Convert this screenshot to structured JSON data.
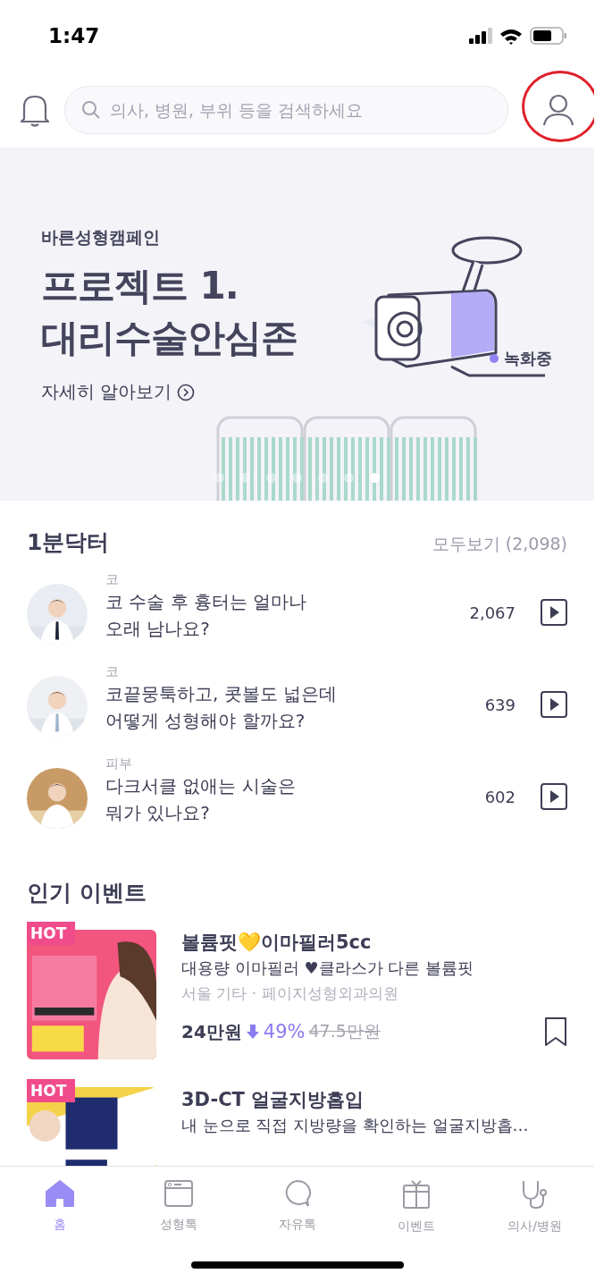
{
  "status_bar": {
    "time": "1:47"
  },
  "header": {
    "search": {
      "placeholder": "의사, 병원, 부위 등을 검색하세요"
    },
    "profile_button": {
      "highlighted": true
    }
  },
  "banner": {
    "eyebrow": "바른성형캠페인",
    "title_lines": [
      "프로젝트 1.",
      "대리수술안심존"
    ],
    "link": "자세히 알아보기",
    "recording_label": "녹화중",
    "pages": [
      {
        "selected": false
      },
      {
        "selected": false
      },
      {
        "selected": false
      },
      {
        "selected": false
      },
      {
        "selected": false
      },
      {
        "selected": false
      },
      {
        "selected": true
      }
    ]
  },
  "doctor_section": {
    "title": "1분닥터",
    "see_all": "모두보기 (2,098)",
    "items": [
      {
        "category": "코",
        "question": "코 수술 후 흉터는 얼마나\n오래 남나요?",
        "views": "2,067"
      },
      {
        "category": "코",
        "question": "코끝뭉툭하고, 콧볼도 넓은데\n어떻게 성형해야 할까요?",
        "views": "639"
      },
      {
        "category": "피부",
        "question": "다크서클 없애는 시술은\n뭐가 있나요?",
        "views": "602"
      }
    ]
  },
  "event_section": {
    "title": "인기 이벤트",
    "items": [
      {
        "badge": "HOT",
        "title": "볼륨핏💛이마필러5cc",
        "subtitle": "대용량 이마필러 ♥클라스가 다른 볼륨핏",
        "location": "서울 기타 · 페이지성형외과의원",
        "price": "24만원",
        "discount": "49%",
        "original_price": "47.5만원",
        "bookmarked": false
      },
      {
        "badge": "HOT",
        "title": "3D-CT 얼굴지방흡입",
        "subtitle": "내 눈으로 직접 지방량을 확인하는 얼굴지방흡…"
      }
    ]
  },
  "tab_bar": [
    {
      "label": "홈",
      "kind": "home",
      "selected": true
    },
    {
      "label": "성형톡",
      "kind": "board",
      "selected": false
    },
    {
      "label": "자유톡",
      "kind": "chat",
      "selected": false
    },
    {
      "label": "이벤트",
      "kind": "gift",
      "selected": false
    },
    {
      "label": "의사/병원",
      "kind": "stethoscope",
      "selected": false
    }
  ]
}
